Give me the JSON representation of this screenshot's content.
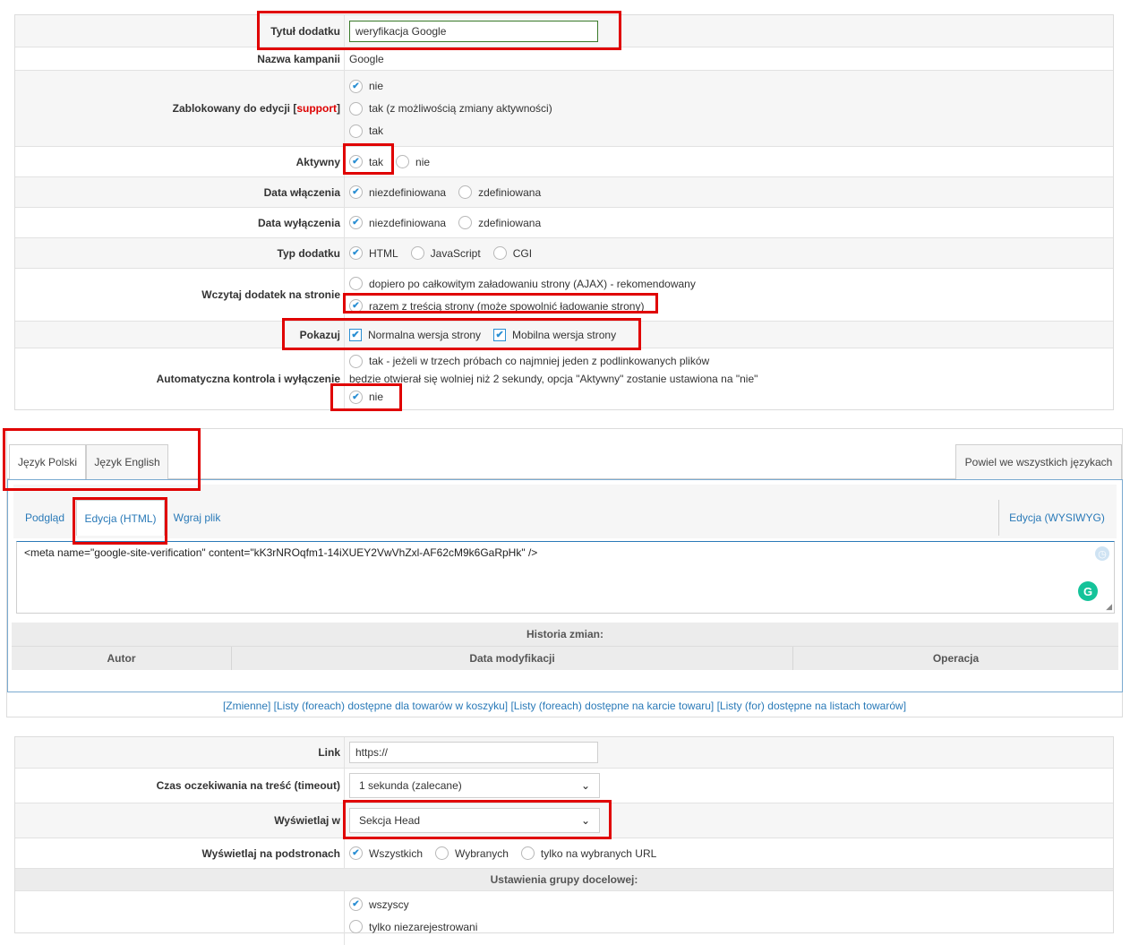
{
  "form1": {
    "title_label": "Tytuł dodatku",
    "title_value": "weryfikacja Google",
    "campaign_label": "Nazwa kampanii",
    "campaign_value": "Google",
    "locked_label_prefix": "Zablokowany do edycji [",
    "locked_label_link": "support",
    "locked_label_suffix": "]",
    "locked_options": [
      "nie",
      "tak (z możliwością zmiany aktywności)",
      "tak"
    ],
    "active_label": "Aktywny",
    "active_options": [
      "tak",
      "nie"
    ],
    "start_label": "Data włączenia",
    "start_options": [
      "niezdefiniowana",
      "zdefiniowana"
    ],
    "end_label": "Data wyłączenia",
    "end_options": [
      "niezdefiniowana",
      "zdefiniowana"
    ],
    "type_label": "Typ dodatku",
    "type_options": [
      "HTML",
      "JavaScript",
      "CGI"
    ],
    "load_label": "Wczytaj dodatek na stronie",
    "load_options": [
      "dopiero po całkowitym załadowaniu strony (AJAX) - rekomendowany",
      "razem z treścią strony (może spowolnić ładowanie strony)"
    ],
    "show_label": "Pokazuj",
    "show_options": [
      "Normalna wersja strony",
      "Mobilna wersja strony"
    ],
    "auto_label": "Automatyczna kontrola i wyłączenie",
    "auto_option_yes_1": "tak - jeżeli w trzech próbach co najmniej jeden z podlinkowanych plików",
    "auto_option_yes_2": "będzie otwierał się wolniej niż 2 sekundy, opcja \"Aktywny\" zostanie ustawiona na \"nie\"",
    "auto_option_no": "nie"
  },
  "lang_tabs": [
    "Język Polski",
    "Język English"
  ],
  "repeat_all": "Powiel we wszystkich językach",
  "editor": {
    "tabs": [
      "Podgląd",
      "Edycja (HTML)",
      "Wgraj plik"
    ],
    "wysiwyg": "Edycja (WYSIWYG)",
    "content": "<meta name=\"google-site-verification\" content=\"kK3rNROqfm1-14iXUEY2VwVhZxl-AF62cM9k6GaRpHk\" />",
    "history_title": "Historia zmian:",
    "history_cols": [
      "Autor",
      "Data modyfikacji",
      "Operacja"
    ]
  },
  "vars_links": [
    "[Zmienne]",
    "[Listy (foreach) dostępne dla towarów w koszyku]",
    "[Listy (foreach) dostępne na karcie towaru]",
    "[Listy (for) dostępne na listach towarów]"
  ],
  "form2": {
    "link_label": "Link",
    "link_value": "https://",
    "timeout_label": "Czas oczekiwania na treść (timeout)",
    "timeout_value": "1 sekunda (zalecane)",
    "display_label": "Wyświetlaj w",
    "display_value": "Sekcja Head",
    "subpages_label": "Wyświetlaj na podstronach",
    "subpages_options": [
      "Wszystkich",
      "Wybranych",
      "tylko na wybranych URL"
    ],
    "target_title": "Ustawienia grupy docelowej:",
    "target_options": [
      "wszyscy",
      "tylko niezarejestrowani"
    ]
  }
}
